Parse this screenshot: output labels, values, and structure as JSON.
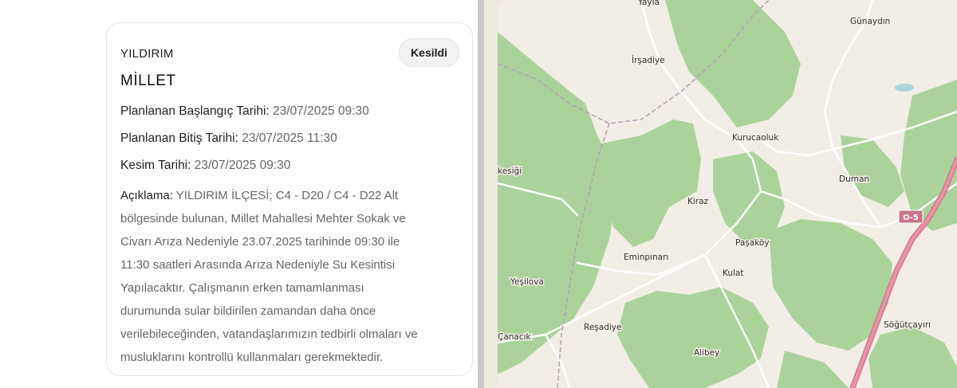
{
  "outage": {
    "district": "YILDIRIM",
    "status": "Kesildi",
    "neighborhood": "MİLLET",
    "planned_start_label": "Planlanan Başlangıç Tarihi:",
    "planned_start_value": "23/07/2025 09:30",
    "planned_end_label": "Planlanan Bitiş Tarihi:",
    "planned_end_value": "23/07/2025 11:30",
    "cut_date_label": "Kesim Tarihi:",
    "cut_date_value": "23/07/2025 09:30",
    "description_label": "Açıklama:",
    "description_lines": [
      "YILDIRIM İLÇESİ; C4 - D20 / C4 - D22 Alt",
      "bölgesinde bulunan, Millet Mahallesi Mehter Sokak ve",
      "Civarı Arıza Nedeniyle 23.07.2025 tarihinde 09:30 ile",
      "11:30 saatleri Arasında Arıza Nedeniyle Su Kesintisi",
      "Yapılacaktır. Çalışmanın erken tamamlanması",
      "durumunda sular bildirilen zamandan daha önce",
      "verilebileceğinden, vatandaşlarımızın tedbirli olmaları ve",
      "musluklarını kontrollü kullanmaları gerekmektedir."
    ]
  },
  "map": {
    "colors": {
      "land": "#f2eee6",
      "forest": "#acd29c",
      "road": "#ffffff",
      "highway": "#e892a2",
      "water": "#aad3df"
    },
    "places": [
      "Yayla",
      "Günaydın",
      "İrşadiye",
      "Kurucaoluk",
      "Duman",
      "Kiraz",
      "Paşaköy",
      "Eminpınarı",
      "Kulat",
      "Yeşilova",
      "Reşadiye",
      "Alibey",
      "Söğütçayırı",
      "Çanacık",
      "kesiği"
    ],
    "road_shield": "O-5"
  }
}
